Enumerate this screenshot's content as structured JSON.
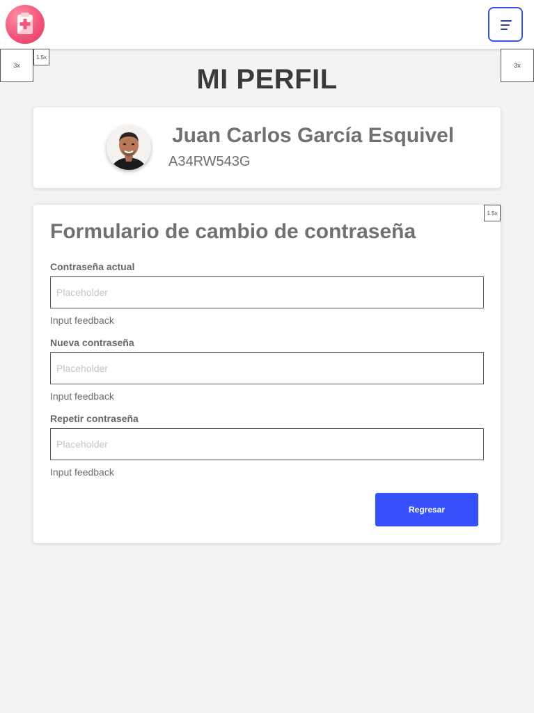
{
  "header": {
    "logo_icon": "medical-clipboard-icon",
    "menu_icon": "menu-lines-icon",
    "accent_color": "#3a4ff0"
  },
  "placeholders": {
    "left_large": "3x",
    "left_small": "1.5x",
    "right_large": "3x",
    "form_small": "1.5x"
  },
  "page_title": "MI PERFIL",
  "profile": {
    "name": "Juan Carlos García Esquivel",
    "id": "A34RW543G"
  },
  "form": {
    "title": "Formulario de cambio de contraseña",
    "fields": [
      {
        "label": "Contraseña actual",
        "placeholder": "Placeholder",
        "feedback": "Input feedback"
      },
      {
        "label": "Nueva contraseña",
        "placeholder": "Placeholder",
        "feedback": "Input feedback"
      },
      {
        "label": "Repetir contraseña",
        "placeholder": "Placeholder",
        "feedback": "Input feedback"
      }
    ],
    "back_button": "Regresar",
    "button_color": "#3651fb"
  }
}
